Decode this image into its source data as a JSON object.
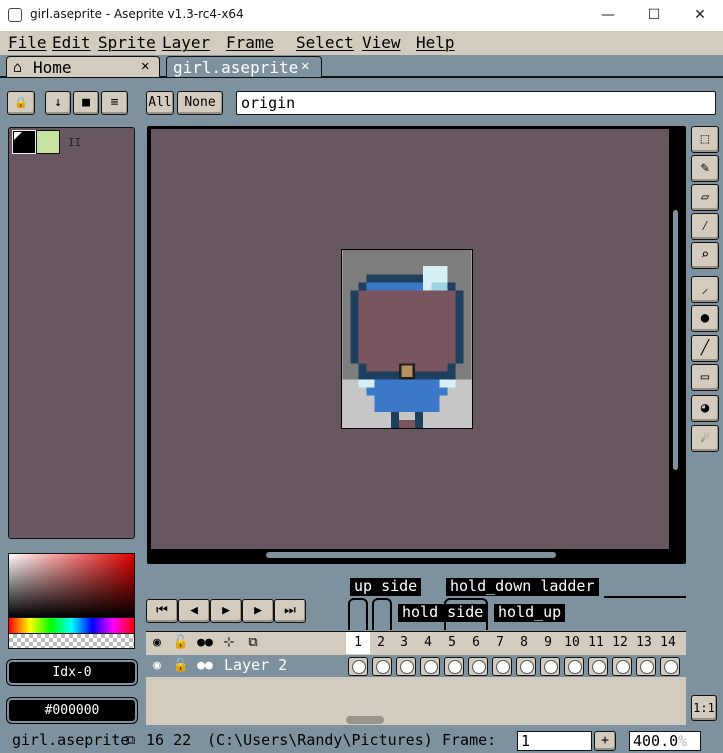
{
  "window": {
    "title": "girl.aseprite - Aseprite v1.3-rc4-x64",
    "minimize_glyph": "—",
    "maximize_glyph": "☐",
    "close_glyph": "✕"
  },
  "menu": [
    "File",
    "Edit",
    "Sprite",
    "Layer",
    "Frame",
    "Select",
    "View",
    "Help"
  ],
  "tabs": [
    {
      "label": "Home",
      "icon": "home-icon",
      "close": "✕"
    },
    {
      "label": "girl.aseprite",
      "close": "✕"
    }
  ],
  "toolbar": {
    "lock_icon": "🔒",
    "down_icon": "↓",
    "square_icon": "■",
    "list_icon": "≡",
    "all_label": "All",
    "none_label": "None",
    "layer_search_value": "origin"
  },
  "palette": {
    "grip": "II",
    "fg_color": "#000000",
    "bg_color": "#c7e29e"
  },
  "color_bar": {
    "index_label": "Idx-0",
    "hex_label": "#000000"
  },
  "colors": {
    "canvas_bg": "#685660",
    "panel_face": "#d3cbbd",
    "workspace": "#7d929e",
    "accent_dark": "#000000"
  },
  "tools": [
    "rectangular-marquee-icon",
    "pencil-icon",
    "eraser-icon",
    "eyedropper-icon",
    "zoom-icon",
    "spray-icon",
    "paint-bucket-icon",
    "line-icon",
    "rectangle-icon",
    "contour-icon",
    "blur-icon"
  ],
  "timeline": {
    "tags": [
      {
        "name": "up side"
      },
      {
        "name": "hold_down ladder"
      },
      {
        "name": "hold side"
      },
      {
        "name": "hold_up"
      }
    ],
    "playback": [
      "first-frame",
      "previous-frame",
      "play",
      "next-frame",
      "last-frame"
    ],
    "layer_name": "Layer 2",
    "frames": [
      "1",
      "2",
      "3",
      "4",
      "5",
      "6",
      "7",
      "8",
      "9",
      "10",
      "11",
      "12",
      "13",
      "14"
    ],
    "active_frame": "1",
    "reset_zoom_label": "1:1"
  },
  "status": {
    "file": "girl.aseprite",
    "size": "16 22",
    "path": "(C:\\Users\\Randy\\Pictures)",
    "frame_label": "Frame:",
    "frame_value": "1",
    "plus": "+",
    "zoom": "400.0",
    "zoom_unit": "%"
  }
}
